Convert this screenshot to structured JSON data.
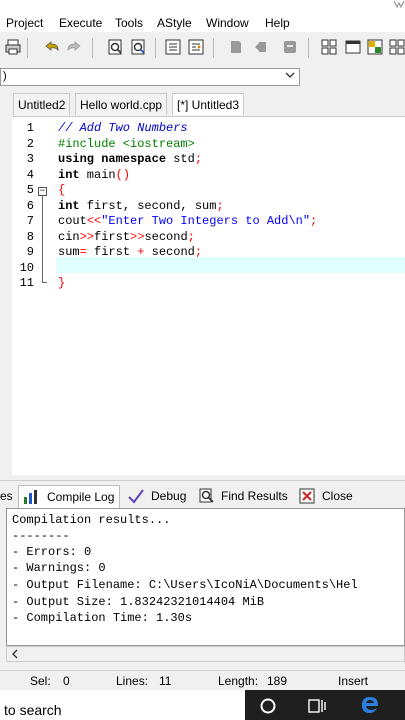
{
  "menu": [
    "Project",
    "Execute",
    "Tools",
    "AStyle",
    "Window",
    "Help"
  ],
  "combo": {
    "value": ")"
  },
  "tabs": [
    "Untitled2",
    "Hello world.cpp",
    "[*] Untitled3"
  ],
  "editor": {
    "line_numbers": [
      "1",
      "2",
      "3",
      "4",
      "5",
      "6",
      "7",
      "8",
      "9",
      "10",
      "11"
    ],
    "fold_open": "−"
  },
  "code": {
    "l1": "// Add Two Numbers",
    "l2": "#include <iostream>",
    "l3_kw": "using namespace",
    "l3_rest": " std",
    "l3_sym": ";",
    "l4_kw": "int",
    "l4_rest": " main",
    "l4_sym": "()",
    "l5_sym": "{",
    "l6_kw": "int",
    "l6_rest": " first, second, sum",
    "l6_sym": ";",
    "l7_a": "cout",
    "l7_op": "<<",
    "l7_str": "\"Enter Two Integers to Add\\n\"",
    "l7_sym": ";",
    "l8_a": "cin",
    "l8_op1": ">>",
    "l8_b": "first",
    "l8_op2": ">>",
    "l8_c": "second",
    "l8_sym": ";",
    "l9_a": "sum",
    "l9_op": "=",
    "l9_b": " first ",
    "l9_plus": "+",
    "l9_c": " second",
    "l9_sym": ";",
    "l11_sym": "}"
  },
  "bottom_tabs": {
    "partial": "es",
    "compile_log": "Compile Log",
    "debug": "Debug",
    "find_results": "Find Results",
    "close": "Close"
  },
  "log": [
    "Compilation results...",
    "--------",
    "- Errors: 0",
    "- Warnings: 0",
    "- Output Filename: C:\\Users\\IcoNiA\\Documents\\Hel",
    "- Output Size: 1.83242321014404 MiB",
    "- Compilation Time: 1.30s"
  ],
  "status": {
    "sel_label": "Sel:",
    "sel_value": "0",
    "lines_label": "Lines:",
    "lines_value": "11",
    "length_label": "Length:",
    "length_value": "189",
    "mode": "Insert"
  },
  "taskbar": {
    "search_text": "to search"
  }
}
